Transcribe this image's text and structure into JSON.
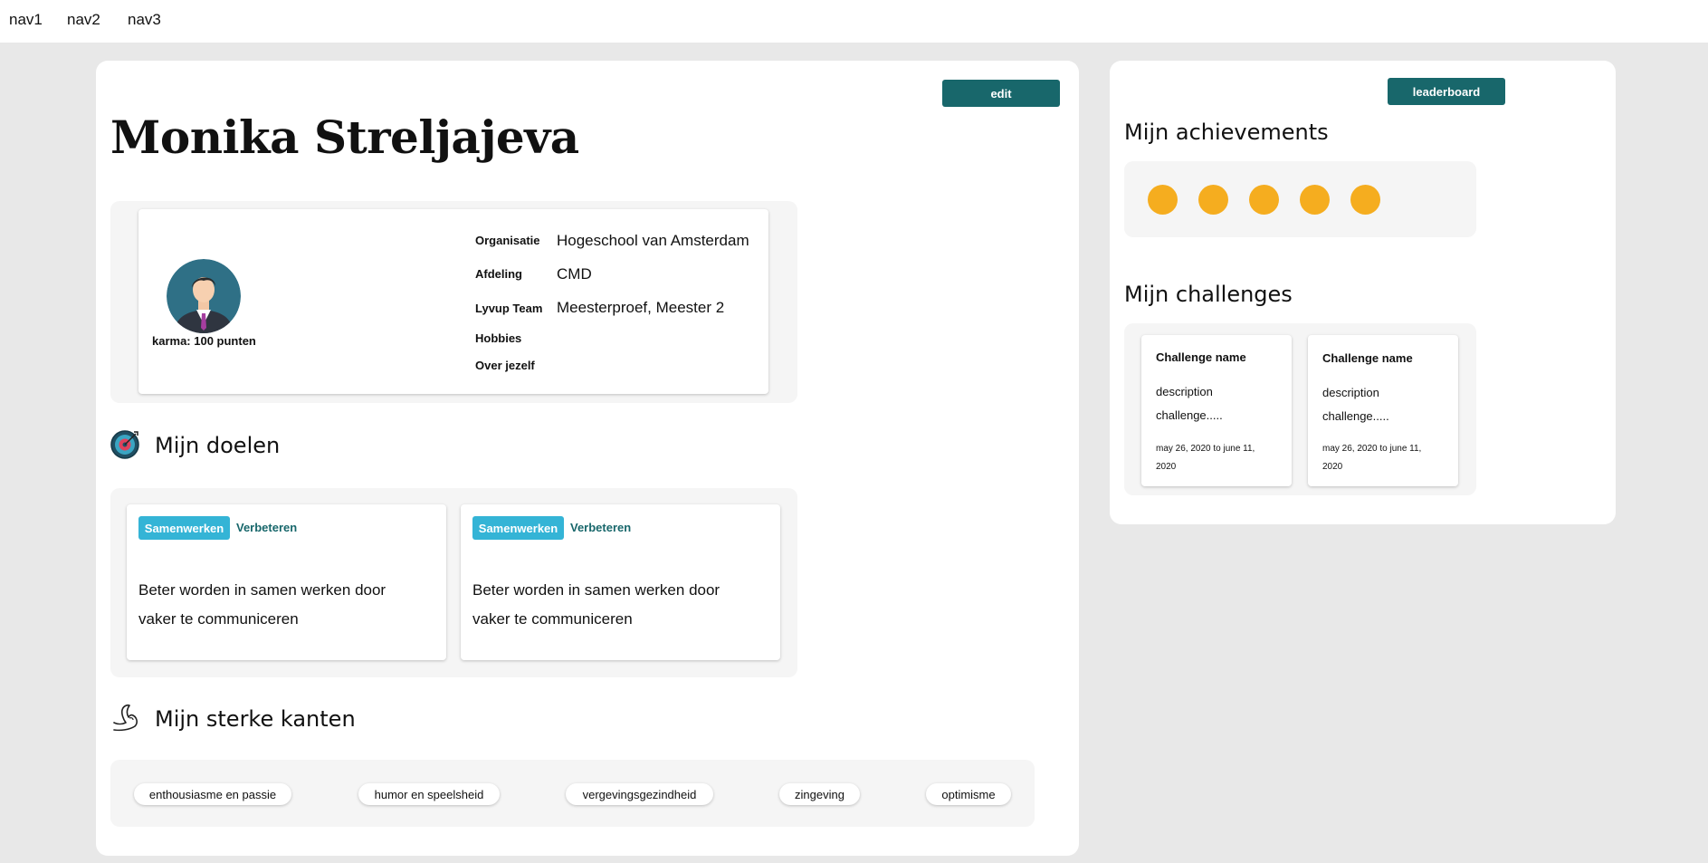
{
  "nav": [
    "nav1",
    "nav2",
    "nav3"
  ],
  "profile": {
    "edit_label": "edit",
    "name": "Monika Streljajeva",
    "karma": "karma: 100 punten",
    "fields": [
      {
        "label": "Organisatie",
        "value": "Hogeschool van Amsterdam"
      },
      {
        "label": "Afdeling",
        "value": "CMD"
      },
      {
        "label": "Lyvup Team",
        "value": "Meesterproef, Meester 2"
      },
      {
        "label": "Hobbies",
        "value": ""
      },
      {
        "label": "Over jezelf",
        "value": ""
      }
    ]
  },
  "goals": {
    "title": "Mijn doelen",
    "icon": "target-icon",
    "items": [
      {
        "tag": "Samenwerken",
        "status": "Verbeteren",
        "description": "Beter worden in samen werken door vaker te communiceren"
      },
      {
        "tag": "Samenwerken",
        "status": "Verbeteren",
        "description": "Beter worden in samen werken door vaker te communiceren"
      }
    ]
  },
  "strengths": {
    "title": "Mijn sterke kanten",
    "icon": "flexed-arm-icon",
    "items": [
      "enthousiasme en passie",
      "humor en speelsheid",
      "vergevingsgezindheid",
      "zingeving",
      "optimisme"
    ]
  },
  "sidebar": {
    "leaderboard_label": "leaderboard",
    "achievements_title": "Mijn achievements",
    "achievements": [
      {
        "color": "#f5ad1f"
      },
      {
        "color": "#f5ad1f"
      },
      {
        "color": "#f5ad1f"
      },
      {
        "color": "#f5ad1f"
      },
      {
        "color": "#f5ad1f"
      }
    ],
    "challenges_title": "Mijn challenges",
    "challenges": [
      {
        "name": "Challenge name",
        "description": "description challenge.....",
        "date": "may 26, 2020 to june 11, 2020"
      },
      {
        "name": "Challenge name",
        "description": "description challenge.....",
        "date": "may 26, 2020 to june 11, 2020"
      }
    ]
  },
  "colors": {
    "accent": "#18676b",
    "tag": "#34b4d6",
    "badge": "#f5ad1f",
    "background": "#e8e8e8"
  }
}
